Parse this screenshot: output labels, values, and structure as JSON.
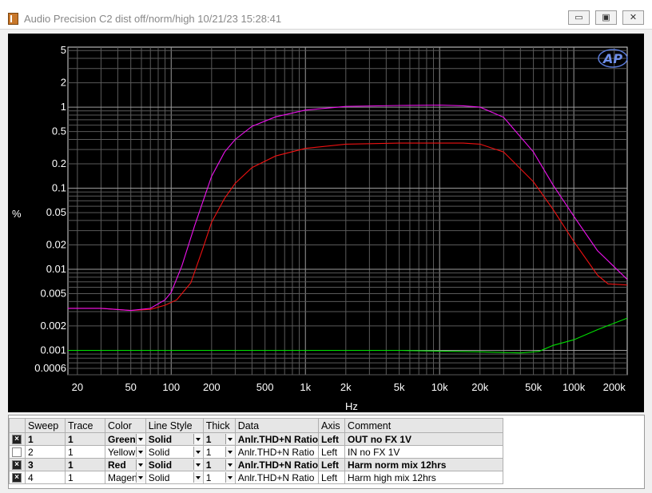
{
  "window": {
    "title": "Audio Precision  C2 dist off/norm/high  10/21/23 15:28:41",
    "minimize_glyph": "▭",
    "maximize_glyph": "▣",
    "close_glyph": "✕"
  },
  "chart_data": {
    "type": "line",
    "title": "",
    "xlabel": "Hz",
    "ylabel": "%",
    "x_scale": "log",
    "y_scale": "log",
    "xlim": [
      17,
      250000
    ],
    "ylim": [
      0.0005,
      5.5
    ],
    "grid": true,
    "logo_text": "AP",
    "x_ticks": [
      {
        "value": 20,
        "label": "20"
      },
      {
        "value": 50,
        "label": "50"
      },
      {
        "value": 100,
        "label": "100"
      },
      {
        "value": 200,
        "label": "200"
      },
      {
        "value": 500,
        "label": "500"
      },
      {
        "value": 1000,
        "label": "1k"
      },
      {
        "value": 2000,
        "label": "2k"
      },
      {
        "value": 5000,
        "label": "5k"
      },
      {
        "value": 10000,
        "label": "10k"
      },
      {
        "value": 20000,
        "label": "20k"
      },
      {
        "value": 50000,
        "label": "50k"
      },
      {
        "value": 100000,
        "label": "100k"
      },
      {
        "value": 200000,
        "label": "200k"
      }
    ],
    "y_ticks": [
      {
        "value": 5,
        "label": "5"
      },
      {
        "value": 2,
        "label": "2"
      },
      {
        "value": 1,
        "label": "1"
      },
      {
        "value": 0.5,
        "label": "0.5"
      },
      {
        "value": 0.2,
        "label": "0.2"
      },
      {
        "value": 0.1,
        "label": "0.1"
      },
      {
        "value": 0.05,
        "label": "0.05"
      },
      {
        "value": 0.02,
        "label": "0.02"
      },
      {
        "value": 0.01,
        "label": "0.01"
      },
      {
        "value": 0.005,
        "label": "0.005"
      },
      {
        "value": 0.002,
        "label": "0.002"
      },
      {
        "value": 0.001,
        "label": "0.001"
      },
      {
        "value": 0.0006,
        "label": "0.0006"
      }
    ],
    "series": [
      {
        "name": "OUT no FX 1V",
        "color": "#00e000",
        "points": [
          [
            17,
            0.001
          ],
          [
            50,
            0.001
          ],
          [
            200,
            0.001
          ],
          [
            1000,
            0.001
          ],
          [
            5000,
            0.001
          ],
          [
            10000,
            0.00098
          ],
          [
            20000,
            0.00096
          ],
          [
            40000,
            0.00093
          ],
          [
            55000,
            0.00097
          ],
          [
            70000,
            0.00115
          ],
          [
            100000,
            0.00135
          ],
          [
            150000,
            0.0018
          ],
          [
            250000,
            0.0025
          ]
        ]
      },
      {
        "name": "Harm norm mix 12hrs",
        "color": "#ee1111",
        "points": [
          [
            17,
            0.0033
          ],
          [
            30,
            0.0033
          ],
          [
            50,
            0.0031
          ],
          [
            70,
            0.0032
          ],
          [
            90,
            0.0036
          ],
          [
            110,
            0.0042
          ],
          [
            140,
            0.0068
          ],
          [
            170,
            0.017
          ],
          [
            200,
            0.038
          ],
          [
            250,
            0.075
          ],
          [
            300,
            0.115
          ],
          [
            400,
            0.18
          ],
          [
            600,
            0.25
          ],
          [
            1000,
            0.31
          ],
          [
            2000,
            0.35
          ],
          [
            5000,
            0.36
          ],
          [
            10000,
            0.36
          ],
          [
            15000,
            0.36
          ],
          [
            20000,
            0.35
          ],
          [
            30000,
            0.28
          ],
          [
            50000,
            0.12
          ],
          [
            70000,
            0.055
          ],
          [
            100000,
            0.022
          ],
          [
            150000,
            0.0085
          ],
          [
            180000,
            0.0066
          ],
          [
            250000,
            0.0064
          ]
        ]
      },
      {
        "name": "Harm high mix 12hrs",
        "color": "#ee11ee",
        "points": [
          [
            17,
            0.0033
          ],
          [
            30,
            0.0033
          ],
          [
            50,
            0.0031
          ],
          [
            70,
            0.0033
          ],
          [
            90,
            0.0042
          ],
          [
            100,
            0.0052
          ],
          [
            120,
            0.011
          ],
          [
            150,
            0.035
          ],
          [
            200,
            0.14
          ],
          [
            250,
            0.28
          ],
          [
            300,
            0.4
          ],
          [
            400,
            0.58
          ],
          [
            600,
            0.76
          ],
          [
            1000,
            0.92
          ],
          [
            2000,
            1.02
          ],
          [
            5000,
            1.05
          ],
          [
            10000,
            1.06
          ],
          [
            15000,
            1.04
          ],
          [
            20000,
            1.0
          ],
          [
            30000,
            0.75
          ],
          [
            50000,
            0.28
          ],
          [
            70000,
            0.11
          ],
          [
            100000,
            0.045
          ],
          [
            150000,
            0.017
          ],
          [
            250000,
            0.0075
          ]
        ]
      }
    ]
  },
  "legend": {
    "headers": [
      "",
      "Sweep",
      "Trace",
      "Color",
      "Line Style",
      "Thick",
      "Data",
      "Axis",
      "Comment"
    ],
    "rows": [
      {
        "checked": true,
        "selected": true,
        "sweep": "1",
        "trace": "1",
        "color": "Green",
        "line_style": "Solid",
        "thick": "1",
        "data": "Anlr.THD+N Ratio",
        "axis": "Left",
        "comment": "OUT no FX 1V"
      },
      {
        "checked": false,
        "selected": false,
        "sweep": "2",
        "trace": "1",
        "color": "Yellow",
        "line_style": "Solid",
        "thick": "1",
        "data": "Anlr.THD+N Ratio",
        "axis": "Left",
        "comment": "IN no FX 1V"
      },
      {
        "checked": true,
        "selected": true,
        "sweep": "3",
        "trace": "1",
        "color": "Red",
        "line_style": "Solid",
        "thick": "1",
        "data": "Anlr.THD+N Ratio",
        "axis": "Left",
        "comment": "Harm norm mix 12hrs"
      },
      {
        "checked": true,
        "selected": false,
        "sweep": "4",
        "trace": "1",
        "color": "Magenta",
        "line_style": "Solid",
        "thick": "1",
        "data": "Anlr.THD+N Ratio",
        "axis": "Left",
        "comment": "Harm high mix 12hrs"
      }
    ]
  }
}
